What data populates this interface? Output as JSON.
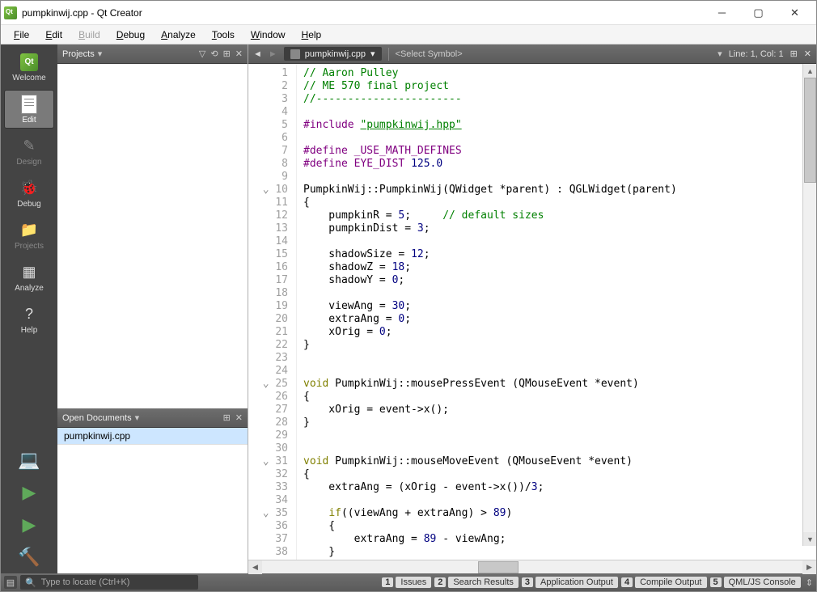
{
  "window": {
    "title": "pumpkinwij.cpp - Qt Creator"
  },
  "menus": [
    "File",
    "Edit",
    "Build",
    "Debug",
    "Analyze",
    "Tools",
    "Window",
    "Help"
  ],
  "menu_disabled": [
    "Build"
  ],
  "modes": [
    {
      "id": "welcome",
      "label": "Welcome",
      "icon": "qt-logo-icon"
    },
    {
      "id": "edit",
      "label": "Edit",
      "icon": "document-icon",
      "active": true
    },
    {
      "id": "design",
      "label": "Design",
      "icon": "brush-icon",
      "disabled": true
    },
    {
      "id": "debug",
      "label": "Debug",
      "icon": "bug-icon"
    },
    {
      "id": "projects",
      "label": "Projects",
      "icon": "folder-icon",
      "disabled": true
    },
    {
      "id": "analyze",
      "label": "Analyze",
      "icon": "chart-icon"
    },
    {
      "id": "help",
      "label": "Help",
      "icon": "help-icon"
    }
  ],
  "run_actions": [
    {
      "id": "comp",
      "icon": "computer-icon"
    },
    {
      "id": "play",
      "icon": "play-icon"
    },
    {
      "id": "playdbg",
      "icon": "play-debug-icon"
    },
    {
      "id": "build",
      "icon": "hammer-icon"
    }
  ],
  "projects": {
    "title": "Projects",
    "open_docs_title": "Open Documents",
    "open_doc": "pumpkinwij.cpp"
  },
  "editor": {
    "nav_back": "◄",
    "nav_fwd": "►",
    "filename": "pumpkinwij.cpp",
    "symbol_placeholder": "<Select Symbol>",
    "cursor": "Line: 1, Col: 1"
  },
  "code_lines": [
    {
      "n": 1,
      "type": "comment",
      "text": "// Aaron Pulley"
    },
    {
      "n": 2,
      "type": "comment",
      "text": "// ME 570 final project"
    },
    {
      "n": 3,
      "type": "comment",
      "text": "//-----------------------"
    },
    {
      "n": 4,
      "type": "blank",
      "text": ""
    },
    {
      "n": 5,
      "type": "include",
      "pre": "#include ",
      "str": "\"pumpkinwij.hpp\""
    },
    {
      "n": 6,
      "type": "blank",
      "text": ""
    },
    {
      "n": 7,
      "type": "define",
      "pre": "#define ",
      "rest": "_USE_MATH_DEFINES"
    },
    {
      "n": 8,
      "type": "define",
      "pre": "#define ",
      "name": "EYE_DIST ",
      "val": "125.0"
    },
    {
      "n": 9,
      "type": "blank",
      "text": ""
    },
    {
      "n": 10,
      "fold": true,
      "text": "PumpkinWij::PumpkinWij(QWidget *parent) : QGLWidget(parent)"
    },
    {
      "n": 11,
      "text": "{"
    },
    {
      "n": 12,
      "indent": "    ",
      "assign": "pumpkinR = ",
      "val": "5",
      "after": ";     ",
      "comment": "// default sizes"
    },
    {
      "n": 13,
      "indent": "    ",
      "assign": "pumpkinDist = ",
      "val": "3",
      "after": ";"
    },
    {
      "n": 14,
      "text": ""
    },
    {
      "n": 15,
      "indent": "    ",
      "assign": "shadowSize = ",
      "val": "12",
      "after": ";"
    },
    {
      "n": 16,
      "indent": "    ",
      "assign": "shadowZ = ",
      "val": "18",
      "after": ";"
    },
    {
      "n": 17,
      "indent": "    ",
      "assign": "shadowY = ",
      "val": "0",
      "after": ";"
    },
    {
      "n": 18,
      "text": ""
    },
    {
      "n": 19,
      "indent": "    ",
      "assign": "viewAng = ",
      "val": "30",
      "after": ";"
    },
    {
      "n": 20,
      "indent": "    ",
      "assign": "extraAng = ",
      "val": "0",
      "after": ";"
    },
    {
      "n": 21,
      "indent": "    ",
      "assign": "xOrig = ",
      "val": "0",
      "after": ";"
    },
    {
      "n": 22,
      "text": "}"
    },
    {
      "n": 23,
      "text": ""
    },
    {
      "n": 24,
      "text": ""
    },
    {
      "n": 25,
      "fold": true,
      "kw": "void",
      "text": " PumpkinWij::mousePressEvent (QMouseEvent *event)"
    },
    {
      "n": 26,
      "text": "{"
    },
    {
      "n": 27,
      "text": "    xOrig = event->x();"
    },
    {
      "n": 28,
      "text": "}"
    },
    {
      "n": 29,
      "text": ""
    },
    {
      "n": 30,
      "text": ""
    },
    {
      "n": 31,
      "fold": true,
      "kw": "void",
      "text": " PumpkinWij::mouseMoveEvent (QMouseEvent *event)"
    },
    {
      "n": 32,
      "text": "{"
    },
    {
      "n": 33,
      "indent": "    ",
      "assign": "extraAng = (xOrig - event->x())/",
      "val": "3",
      "after": ";"
    },
    {
      "n": 34,
      "text": ""
    },
    {
      "n": 35,
      "fold": true,
      "indent": "    ",
      "kw": "if",
      "mid": "((viewAng + extraAng) > ",
      "val": "89",
      "after": ")"
    },
    {
      "n": 36,
      "text": "    {"
    },
    {
      "n": 37,
      "indent": "        ",
      "assign": "extraAng = ",
      "val": "89",
      "after": " - viewAng;"
    },
    {
      "n": 38,
      "text": "    }"
    }
  ],
  "status": {
    "locate_placeholder": "Type to locate (Ctrl+K)",
    "tabs": [
      {
        "n": "1",
        "label": "Issues"
      },
      {
        "n": "2",
        "label": "Search Results"
      },
      {
        "n": "3",
        "label": "Application Output"
      },
      {
        "n": "4",
        "label": "Compile Output"
      },
      {
        "n": "5",
        "label": "QML/JS Console"
      }
    ]
  }
}
